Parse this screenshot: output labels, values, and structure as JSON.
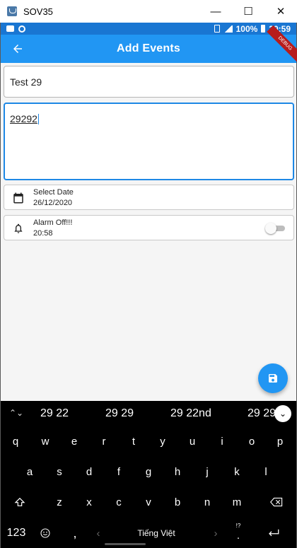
{
  "window": {
    "title": "SOV35",
    "minimize_glyph": "—",
    "maximize_glyph": "☐",
    "close_glyph": "✕"
  },
  "status_bar": {
    "battery": "100%",
    "time": "20:59"
  },
  "app_bar": {
    "title": "Add Events",
    "debug_label": "DEBUG"
  },
  "form": {
    "title_value": "Test 29",
    "description_value": "29292",
    "date_label": "Select Date",
    "date_value": "26/12/2020",
    "alarm_label": "Alarm Off!!!",
    "alarm_time": "20:58",
    "alarm_on": false
  },
  "keyboard": {
    "suggestions": [
      "29 22",
      "29 29",
      "29 22nd",
      "29 29"
    ],
    "row1": [
      "q",
      "w",
      "e",
      "r",
      "t",
      "y",
      "u",
      "i",
      "o",
      "p"
    ],
    "row2": [
      "a",
      "s",
      "d",
      "f",
      "g",
      "h",
      "j",
      "k",
      "l"
    ],
    "row3": [
      "z",
      "x",
      "c",
      "v",
      "b",
      "n",
      "m"
    ],
    "numbers_key": "123",
    "comma_key": ",",
    "space_label": "Tiếng Việt",
    "period_key": ".",
    "period_alt": "!?"
  },
  "colors": {
    "status_bar": "#1976d2",
    "app_bar": "#2196f3",
    "focus_border": "#1e88e5",
    "fab": "#2196f3"
  },
  "icons": {
    "back": "arrow-left-icon",
    "date": "calendar-icon",
    "alarm": "bell-icon",
    "fab": "save-icon"
  }
}
